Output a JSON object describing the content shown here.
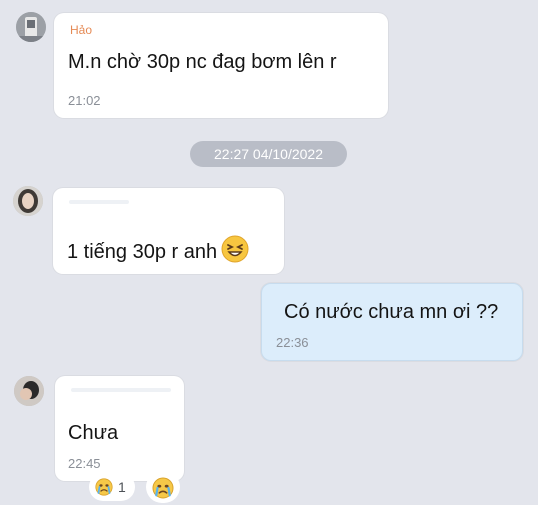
{
  "messages": [
    {
      "sender": "Hảo",
      "text": "M.n chờ 30p nc đag bơm lên r",
      "time": "21:02"
    },
    {
      "text": "1 tiếng 30p r anh",
      "time": "",
      "emoji": "grinning-squinting-face"
    },
    {
      "text": "Có nước chưa mn ơi ??",
      "time": "22:36"
    },
    {
      "text": "Chưa",
      "time": "22:45"
    }
  ],
  "separator": "22:27 04/10/2022",
  "reactions": {
    "count": "1",
    "icon": "crying-face-icon"
  },
  "colors": {
    "background": "#e3e5ec",
    "received_bubble": "#ffffff",
    "sent_bubble": "#dcedfb",
    "separator_pill": "#b9bdc7",
    "sender_name": "#e58a55",
    "timestamp": "#8a8f97"
  }
}
